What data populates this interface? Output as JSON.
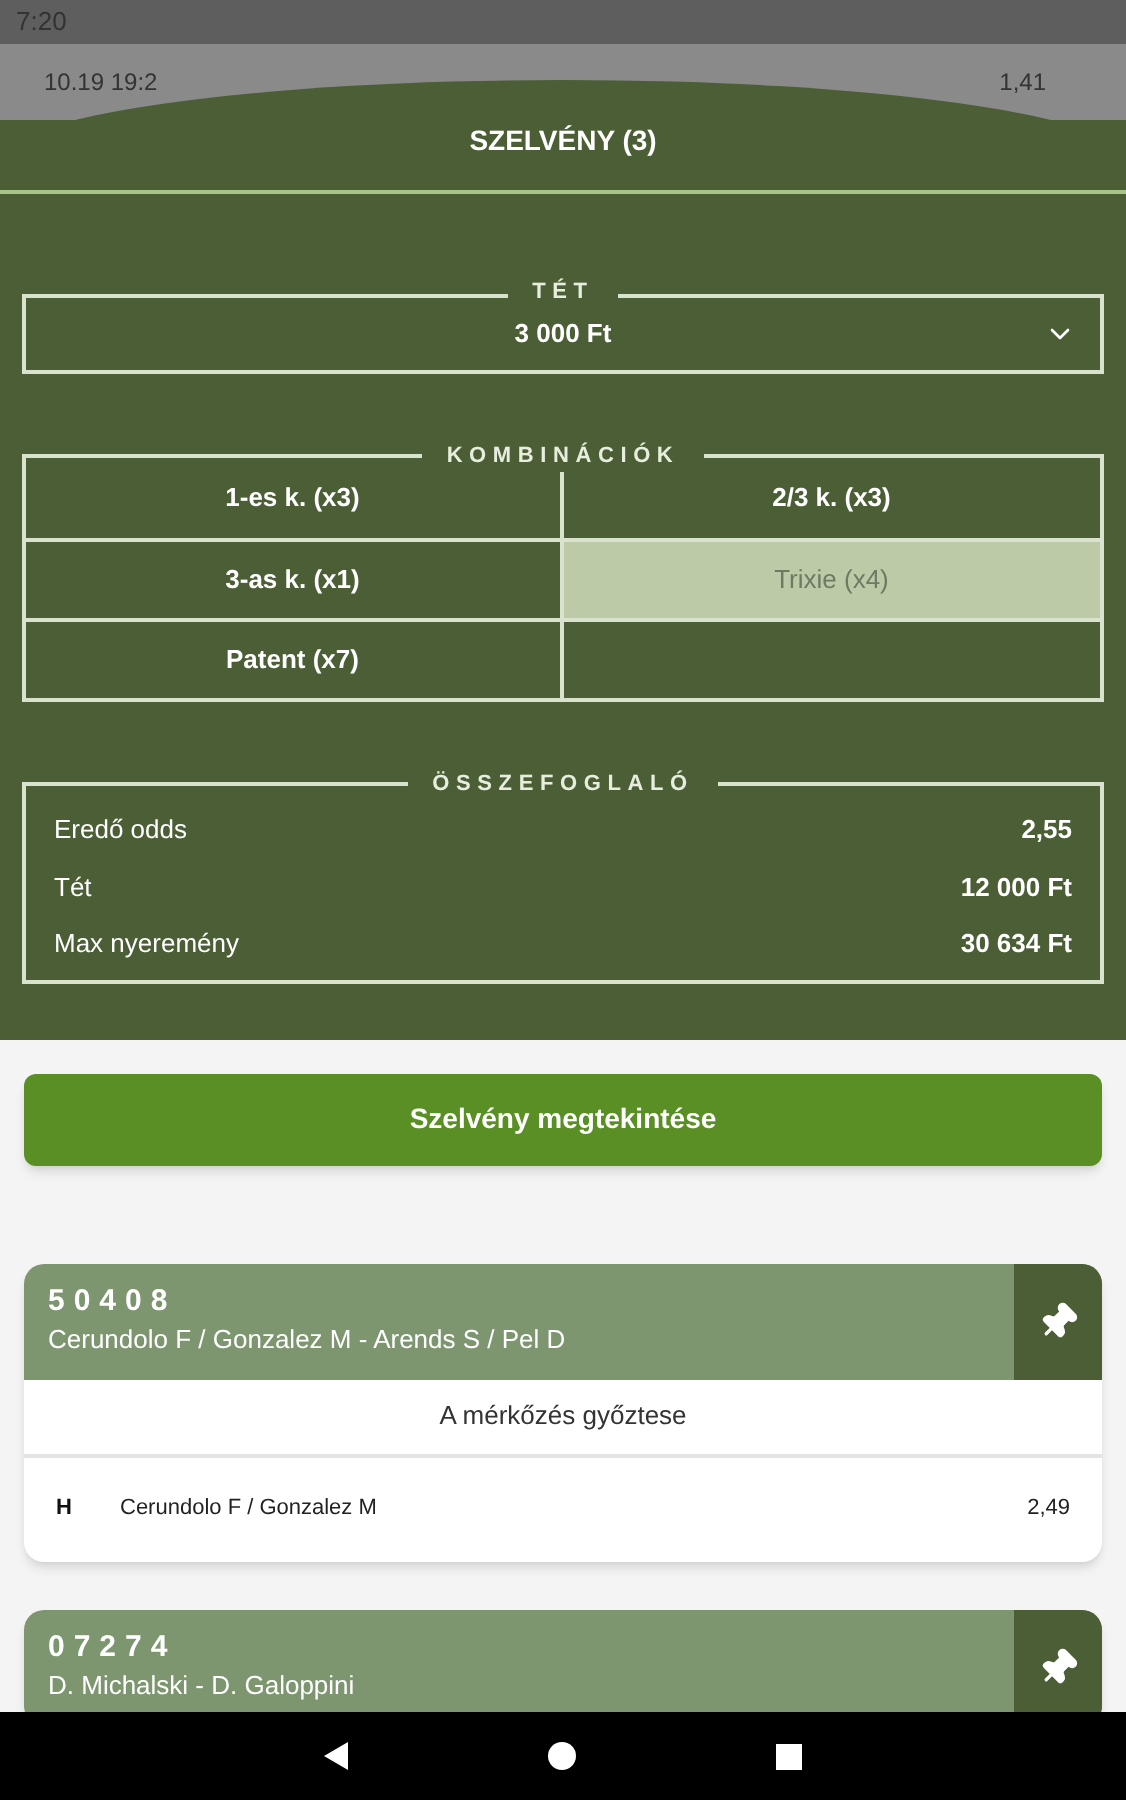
{
  "status_bar": {
    "time": "7:20"
  },
  "background_row": {
    "date": "10.19 19:2",
    "odds": "1,41"
  },
  "sheet": {
    "title": "SZELVÉNY (3)",
    "stake": {
      "legend": "TÉT",
      "value": "3 000 Ft"
    },
    "combinations": {
      "legend": "KOMBINÁCIÓK",
      "items": [
        {
          "label": "1-es k. (x3)",
          "selected": false
        },
        {
          "label": "2/3 k. (x3)",
          "selected": false
        },
        {
          "label": "3-as k. (x1)",
          "selected": false
        },
        {
          "label": "Trixie (x4)",
          "selected": true
        },
        {
          "label": "Patent (x7)",
          "selected": false
        }
      ]
    },
    "summary": {
      "legend": "ÖSSZEFOGLALÓ",
      "rows": [
        {
          "label": "Eredő odds",
          "value": "2,55"
        },
        {
          "label": "Tét",
          "value": "12 000 Ft"
        },
        {
          "label": "Max nyeremény",
          "value": "30 634 Ft"
        }
      ]
    }
  },
  "view_button": "Szelvény megtekintése",
  "events": [
    {
      "code": "50408",
      "title": "Cerundolo F / Gonzalez M - Arends S / Pel D",
      "market": "A mérkőzés győztese",
      "selection": {
        "outcome": "H",
        "name": "Cerundolo F / Gonzalez M",
        "odds": "2,49"
      }
    },
    {
      "code": "07274",
      "title": "D. Michalski - D. Galoppini"
    }
  ]
}
